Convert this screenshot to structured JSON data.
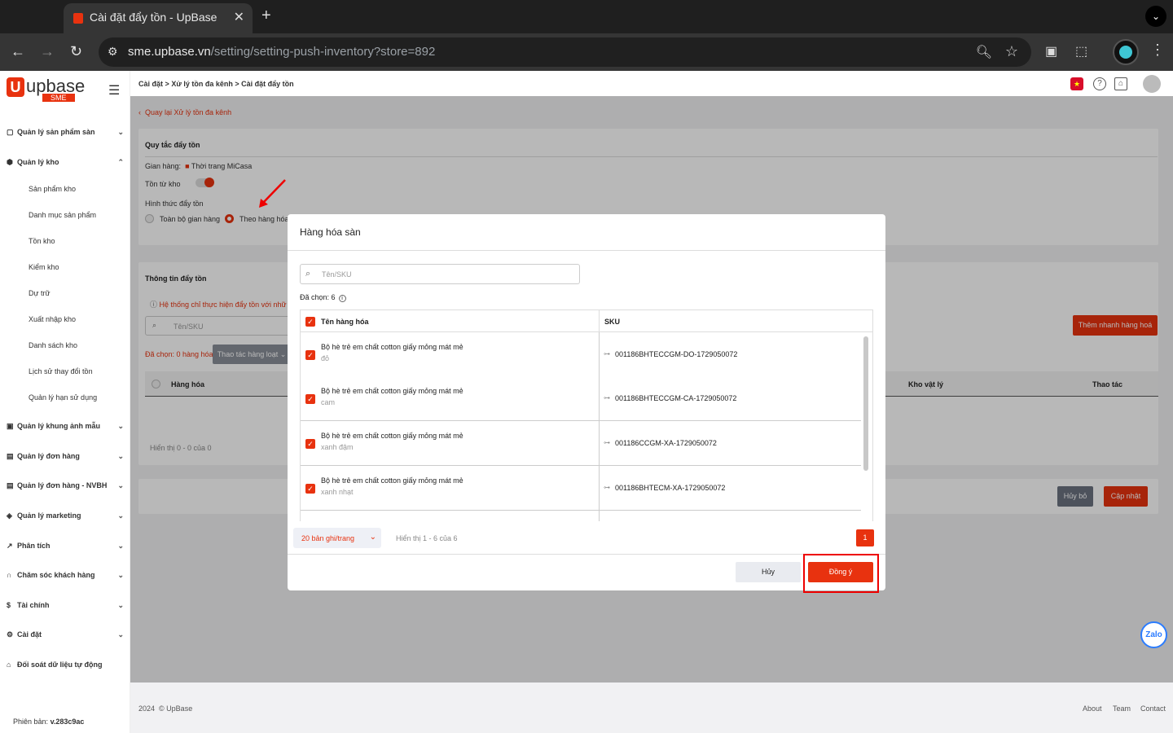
{
  "browser": {
    "tab_title": "Cài đặt đẩy tồn - UpBase",
    "url_host": "sme.upbase.vn",
    "url_path": "/setting/setting-push-inventory?store=892"
  },
  "sidebar": {
    "logo": "upbase",
    "logo_badge": "SME",
    "groups": [
      {
        "label": "Quản lý sản phẩm sàn"
      },
      {
        "label": "Quản lý kho"
      },
      {
        "label": "Quản lý khung ảnh mẫu"
      },
      {
        "label": "Quản lý đơn hàng"
      },
      {
        "label": "Quản lý đơn hàng - NVBH"
      },
      {
        "label": "Quản lý marketing"
      },
      {
        "label": "Phân tích"
      },
      {
        "label": "Chăm sóc khách hàng"
      },
      {
        "label": "Tài chính"
      },
      {
        "label": "Cài đặt"
      },
      {
        "label": "Đối soát dữ liệu tự động"
      }
    ],
    "warehouse_items": [
      "Sản phẩm kho",
      "Danh mục sản phẩm",
      "Tồn kho",
      "Kiểm kho",
      "Dự trữ",
      "Xuất nhập kho",
      "Danh sách kho",
      "Lịch sử thay đổi tồn",
      "Quản lý hạn sử dụng"
    ],
    "version_label": "Phiên bản:",
    "version_value": "v.283c9ac"
  },
  "breadcrumb": {
    "items": [
      "Cài đặt",
      "Xử lý tồn đa kênh",
      "Cài đặt đẩy tồn"
    ],
    "sep": ">"
  },
  "page": {
    "back_link": "Quay lại Xử lý tồn đa kênh",
    "rule_title": "Quy tắc đẩy tồn",
    "store_label": "Gian hàng:",
    "store_name": "Thời trang MiCasa",
    "stock_from_label": "Tồn từ kho",
    "push_type_label": "Hình thức đẩy tồn",
    "option_all": "Toàn bộ gian hàng",
    "option_by_item": "Theo hàng hóa",
    "info_title": "Thông tin đẩy tồn",
    "info_warning": "Hệ thống chỉ thực hiện đẩy tồn với nhữ",
    "search_placeholder": "Tên/SKU",
    "selected_text": "Đã chọn: 0 hàng hóa",
    "bulk_action": "Thao tác hàng loạt",
    "quick_add": "Thêm nhanh hàng hoá",
    "col_item": "Hàng hóa",
    "col_physical": "Kho vật lý",
    "col_action": "Thao tác",
    "showing": "Hiển thị 0 - 0 của 0",
    "cancel_btn": "Hủy bỏ",
    "update_btn": "Cập nhật"
  },
  "modal": {
    "title": "Hàng hóa sàn",
    "search_placeholder": "Tên/SKU",
    "selected_count": "Đã chọn: 6",
    "col_name": "Tên hàng hóa",
    "col_sku": "SKU",
    "rows": [
      {
        "name": "Bộ hè trẻ em chất cotton giấy mỏng mát mẻ",
        "variant": "đỏ",
        "sku": "001186BHTECCGM-DO-1729050072"
      },
      {
        "name": "Bộ hè trẻ em chất cotton giấy mỏng mát mẻ",
        "variant": "cam",
        "sku": "001186BHTECCGM-CA-1729050072"
      },
      {
        "name": "Bộ hè trẻ em chất cotton giấy mỏng mát mẻ",
        "variant": "xanh đậm",
        "sku": "001186CCGM-XA-1729050072"
      },
      {
        "name": "Bộ hè trẻ em chất cotton giấy mỏng mát mẻ",
        "variant": "xanh nhạt",
        "sku": "001186BHTECM-XA-1729050072"
      }
    ],
    "per_page": "20 bản ghi/trang",
    "showing": "Hiển thị 1 - 6 của 6",
    "page": "1",
    "cancel": "Hủy",
    "confirm": "Đồng ý"
  },
  "footer": {
    "copyright_year": "2024",
    "copyright": "© UpBase",
    "links": [
      "About",
      "Team",
      "Contact"
    ]
  },
  "widgets": {
    "zalo": "Zalo"
  },
  "colors": {
    "accent": "#e8320f",
    "overlay": "rgba(0,0,0,0.28)"
  }
}
